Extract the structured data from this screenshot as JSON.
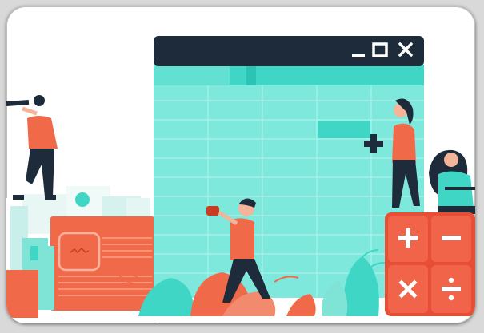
{
  "illustration": {
    "subject": "team-working-on-spreadsheet",
    "window_controls": [
      "minimize-icon",
      "maximize-icon",
      "close-icon"
    ],
    "calculator_keys": [
      "+",
      "−",
      "×",
      "÷"
    ],
    "colors": {
      "window_bar": "#1d2b3a",
      "sheet_teal": "#7ee8dc",
      "sheet_header": "#3fd6c6",
      "accent_orange": "#f06a4a",
      "calc_orange": "#f2644a",
      "dark_navy": "#1d2b3a"
    }
  }
}
